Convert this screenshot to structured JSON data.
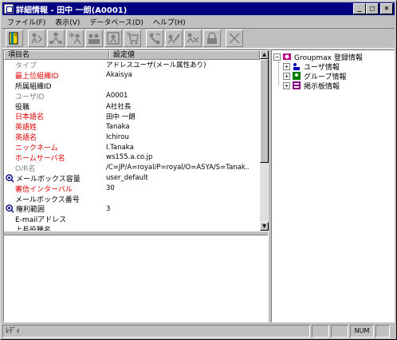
{
  "window": {
    "title": "詳細情報 - 田中 一朗(A0001)",
    "controls": {
      "minimize": "_",
      "maximize": "□",
      "close": "×"
    }
  },
  "menu": [
    {
      "label": "ファイル(F)"
    },
    {
      "label": "表示(V)"
    },
    {
      "label": "データベース(D)"
    },
    {
      "label": "ヘルプ(H)"
    }
  ],
  "toolbar": {
    "icons": [
      "open-book-icon",
      "user-move-icon",
      "user-link-icon",
      "add-user-icon",
      "users-icon",
      "register-icon",
      "cart-icon",
      "connect-icon",
      "edit-icon",
      "delete-icon",
      "lock-icon",
      "cancel-icon"
    ]
  },
  "list": {
    "headers": {
      "name": "項目名",
      "value": "設定値"
    },
    "rows": [
      {
        "label": "タイプ",
        "value": "アドレスユーザ(メール属性あり)",
        "style": "gray",
        "icon": ""
      },
      {
        "label": "最上位組織ID",
        "value": "Akaisya",
        "style": "red",
        "icon": ""
      },
      {
        "label": "所属組織ID",
        "value": "",
        "style": "",
        "icon": ""
      },
      {
        "label": "ユーザID",
        "value": "A0001",
        "style": "gray",
        "icon": ""
      },
      {
        "label": "役職",
        "value": "A社社長",
        "style": "",
        "icon": ""
      },
      {
        "label": "日本語名",
        "value": "田中 一朗",
        "style": "red",
        "icon": ""
      },
      {
        "label": "英語姓",
        "value": "Tanaka",
        "style": "red",
        "icon": ""
      },
      {
        "label": "英語名",
        "value": "Ichirou",
        "style": "red",
        "icon": ""
      },
      {
        "label": "ニックネーム",
        "value": "I.Tanaka",
        "style": "red",
        "icon": ""
      },
      {
        "label": "ホームサーバ名",
        "value": "ws155.a.co.jp",
        "style": "red",
        "icon": ""
      },
      {
        "label": "O/R名",
        "value": "/C=JP/A=royal/P=royal/O=ASYA/S=Tanak...",
        "style": "gray",
        "icon": ""
      },
      {
        "label": "メールボックス容量",
        "value": "user_default",
        "style": "",
        "icon": "search-icon"
      },
      {
        "label": "審信インターバル",
        "value": "30",
        "style": "red",
        "icon": ""
      },
      {
        "label": "メールボックス番号",
        "value": "",
        "style": "",
        "icon": ""
      },
      {
        "label": "権利範囲",
        "value": "3",
        "style": "",
        "icon": "search-icon"
      },
      {
        "label": "E-mailアドレス",
        "value": "",
        "style": "",
        "icon": ""
      },
      {
        "label": "上長役職名",
        "value": "",
        "style": "",
        "icon": ""
      }
    ]
  },
  "tree": {
    "root": {
      "label": "Groupmax 登録情報",
      "expander": "−"
    },
    "children": [
      {
        "label": "ユーザ情報",
        "expander": "+",
        "icon": "user-info-icon"
      },
      {
        "label": "グループ情報",
        "expander": "+",
        "icon": "group-info-icon"
      },
      {
        "label": "掲示板情報",
        "expander": "+",
        "icon": "bulletin-icon"
      }
    ]
  },
  "status": {
    "text": "ﾚﾃﾞｨ",
    "indicators": [
      "",
      "",
      "NUM",
      ""
    ]
  }
}
